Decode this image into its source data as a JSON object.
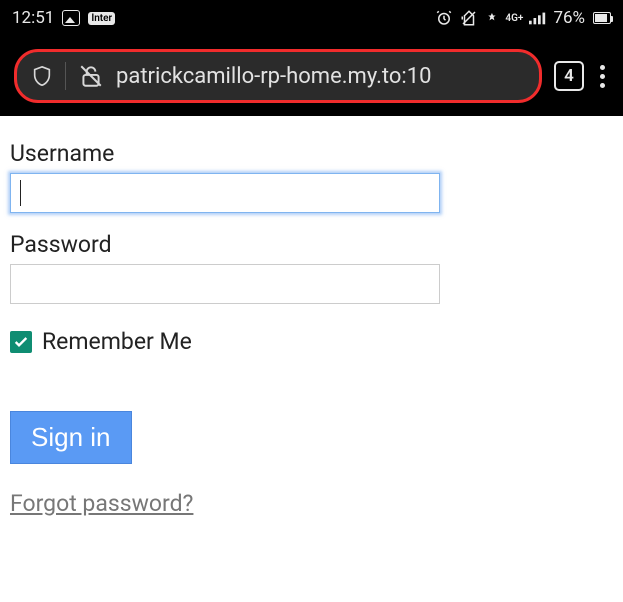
{
  "statusbar": {
    "time": "12:51",
    "inter_label": "Inter",
    "network_label": "4G+",
    "battery_pct": "76%"
  },
  "browser": {
    "url": "patrickcamillo-rp-home.my.to:10",
    "tab_count": "4"
  },
  "form": {
    "username_label": "Username",
    "username_value": "",
    "password_label": "Password",
    "password_value": "",
    "remember_label": "Remember Me",
    "remember_checked": true,
    "signin_label": "Sign in",
    "forgot_label": "Forgot password?"
  }
}
